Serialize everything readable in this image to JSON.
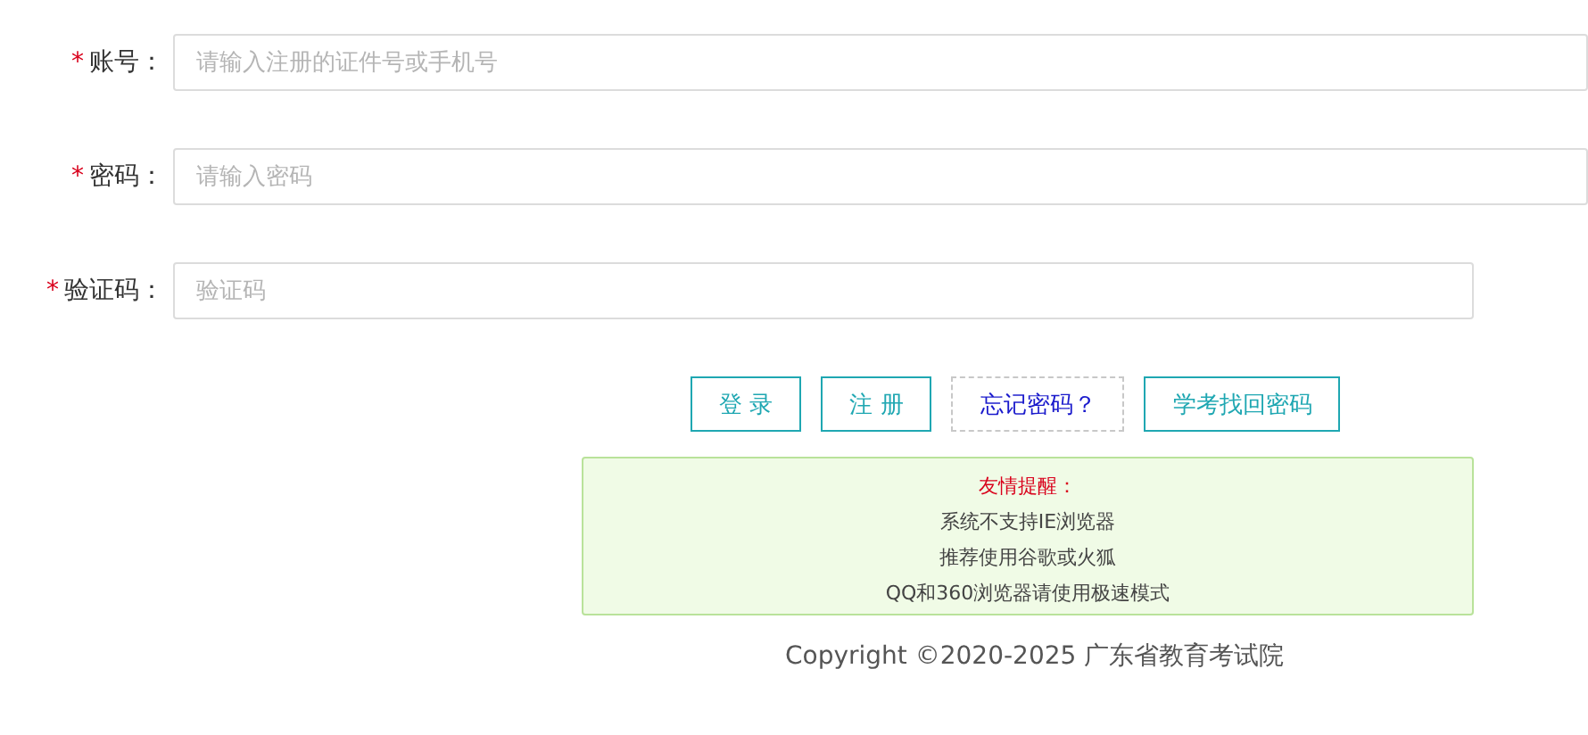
{
  "fields": [
    {
      "label": "账号：",
      "required_mark": "*",
      "placeholder": "请输入注册的证件号或手机号",
      "kind": "text"
    },
    {
      "label": "密码：",
      "required_mark": "*",
      "placeholder": "请输入密码",
      "kind": "password"
    },
    {
      "label": "验证码：",
      "required_mark": "*",
      "placeholder": "验证码",
      "kind": "captcha"
    }
  ],
  "buttons": [
    {
      "label": "登 录",
      "kind": "outlined"
    },
    {
      "label": "注 册",
      "kind": "outlined"
    },
    {
      "label": "忘记密码？",
      "kind": "dashed"
    },
    {
      "label": "学考找回密码",
      "kind": "outlined"
    }
  ],
  "notice": {
    "title": "友情提醒：",
    "lines": [
      "系统不支持IE浏览器",
      "推荐使用谷歌或火狐",
      "QQ和360浏览器请使用极速模式"
    ]
  },
  "footer": "Copyright ©2020-2025 广东省教育考试院"
}
